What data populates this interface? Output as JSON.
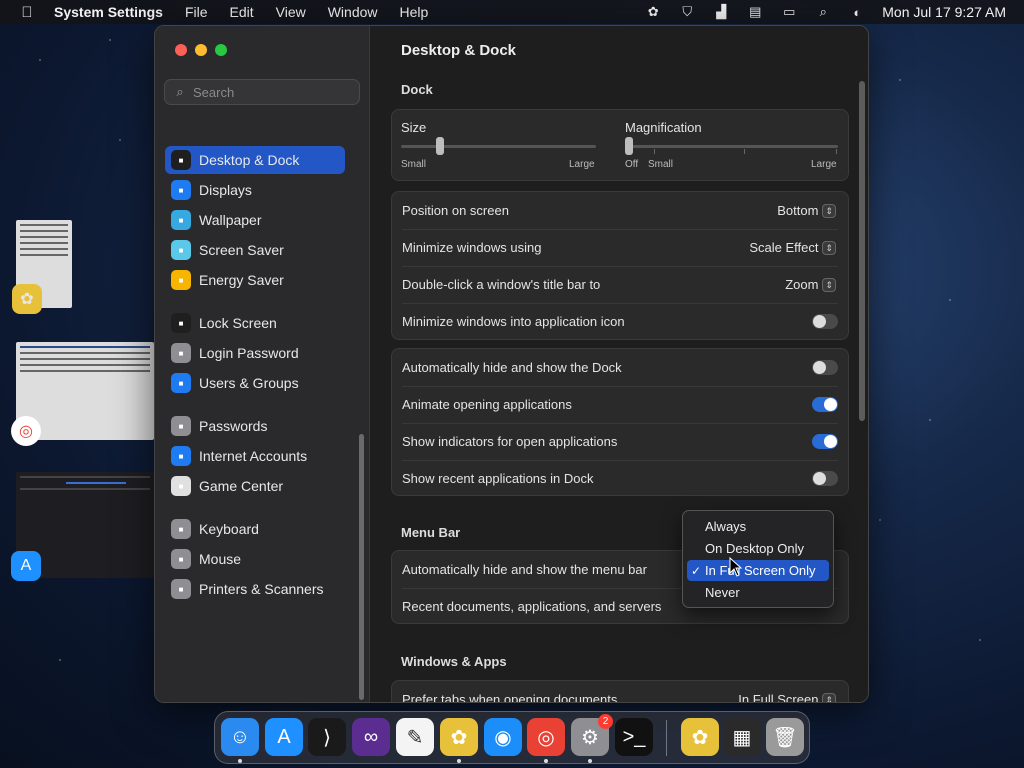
{
  "menubar": {
    "apple": "",
    "app_name": "System Settings",
    "menus": [
      "File",
      "Edit",
      "View",
      "Window",
      "Help"
    ],
    "clock": "Mon Jul 17  9:27 AM"
  },
  "sidebar": {
    "search_placeholder": "Search",
    "items": [
      {
        "label": "Desktop & Dock",
        "icon": "desktop-dock-icon",
        "color": "#1f1f1f"
      },
      {
        "label": "Displays",
        "icon": "displays-icon",
        "color": "#1e7bf2"
      },
      {
        "label": "Wallpaper",
        "icon": "wallpaper-icon",
        "color": "#35a9e0"
      },
      {
        "label": "Screen Saver",
        "icon": "screen-saver-icon",
        "color": "#5ac8e8"
      },
      {
        "label": "Energy Saver",
        "icon": "energy-saver-icon",
        "color": "#f7b500"
      },
      {
        "label": "Lock Screen",
        "icon": "lock-screen-icon",
        "color": "#1f1f1f"
      },
      {
        "label": "Login Password",
        "icon": "login-password-icon",
        "color": "#8e8e93"
      },
      {
        "label": "Users & Groups",
        "icon": "users-groups-icon",
        "color": "#1e7bf2"
      },
      {
        "label": "Passwords",
        "icon": "passwords-icon",
        "color": "#8e8e93"
      },
      {
        "label": "Internet Accounts",
        "icon": "internet-accounts-icon",
        "color": "#1e7bf2"
      },
      {
        "label": "Game Center",
        "icon": "game-center-icon",
        "color": "#e0e0e0"
      },
      {
        "label": "Keyboard",
        "icon": "keyboard-icon",
        "color": "#8e8e93"
      },
      {
        "label": "Mouse",
        "icon": "mouse-icon",
        "color": "#8e8e93"
      },
      {
        "label": "Printers & Scanners",
        "icon": "printers-scanners-icon",
        "color": "#8e8e93"
      }
    ]
  },
  "content": {
    "title": "Desktop & Dock",
    "dock_section": "Dock",
    "size_label": "Size",
    "size_min": "Small",
    "size_max": "Large",
    "size_value": 0.2,
    "magnification_label": "Magnification",
    "mag_off": "Off",
    "mag_min": "Small",
    "mag_max": "Large",
    "mag_value": 0.0,
    "rows_group1": [
      {
        "label": "Position on screen",
        "value": "Bottom"
      },
      {
        "label": "Minimize windows using",
        "value": "Scale Effect"
      },
      {
        "label": "Double-click a window's title bar to",
        "value": "Zoom"
      },
      {
        "label": "Minimize windows into application icon",
        "toggle": false
      }
    ],
    "rows_group2": [
      {
        "label": "Automatically hide and show the Dock",
        "toggle": false
      },
      {
        "label": "Animate opening applications",
        "toggle": true
      },
      {
        "label": "Show indicators for open applications",
        "toggle": true
      },
      {
        "label": "Show recent applications in Dock",
        "toggle": false
      }
    ],
    "menubar_section": "Menu Bar",
    "menubar_rows": [
      {
        "label": "Automatically hide and show the menu bar"
      },
      {
        "label": "Recent documents, applications, and servers"
      }
    ],
    "windows_section": "Windows & Apps",
    "windows_rows": [
      {
        "label": "Prefer tabs when opening documents",
        "value": "In Full Screen"
      }
    ]
  },
  "popup": {
    "items": [
      "Always",
      "On Desktop Only",
      "In Full Screen Only",
      "Never"
    ],
    "selected_index": 2,
    "checkmark": "✓"
  },
  "dock": {
    "apps": [
      {
        "name": "Finder",
        "icon": "finder-icon",
        "color": "#2a8af0",
        "glyph": "☺",
        "running": true
      },
      {
        "name": "App Store",
        "icon": "app-store-icon",
        "color": "#1e90ff",
        "glyph": "A",
        "running": false
      },
      {
        "name": "Visual Studio Code",
        "icon": "vscode-icon",
        "color": "#1a1a1a",
        "glyph": "⟩",
        "running": false
      },
      {
        "name": "Visual Studio",
        "icon": "visual-studio-icon",
        "color": "#5c2d91",
        "glyph": "∞",
        "running": false
      },
      {
        "name": "TextEdit",
        "icon": "textedit-icon",
        "color": "#f4f4f4",
        "glyph": "✎",
        "running": false
      },
      {
        "name": "Cyberduck",
        "icon": "bee-app-icon",
        "color": "#e8c13a",
        "glyph": "✿",
        "running": true
      },
      {
        "name": "Safari",
        "icon": "safari-icon",
        "color": "#1c8ef9",
        "glyph": "◉",
        "running": false
      },
      {
        "name": "Chrome",
        "icon": "chrome-icon",
        "color": "#e94235",
        "glyph": "◎",
        "running": true
      },
      {
        "name": "System Settings",
        "icon": "system-settings-icon",
        "color": "#8e8e93",
        "glyph": "⚙",
        "running": true,
        "badge": "2"
      },
      {
        "name": "Terminal",
        "icon": "terminal-icon",
        "color": "#111111",
        "glyph": ">_",
        "running": false
      },
      {
        "name": "Cyberduck Recent",
        "icon": "bee-recent-icon",
        "color": "#e8c13a",
        "glyph": "✿",
        "running": false
      },
      {
        "name": "Downloads",
        "icon": "downloads-folder-icon",
        "color": "#2a2a2a",
        "glyph": "▦",
        "running": false
      },
      {
        "name": "Trash",
        "icon": "trash-icon",
        "color": "#9a9a9a",
        "glyph": "🗑",
        "running": false
      }
    ]
  }
}
